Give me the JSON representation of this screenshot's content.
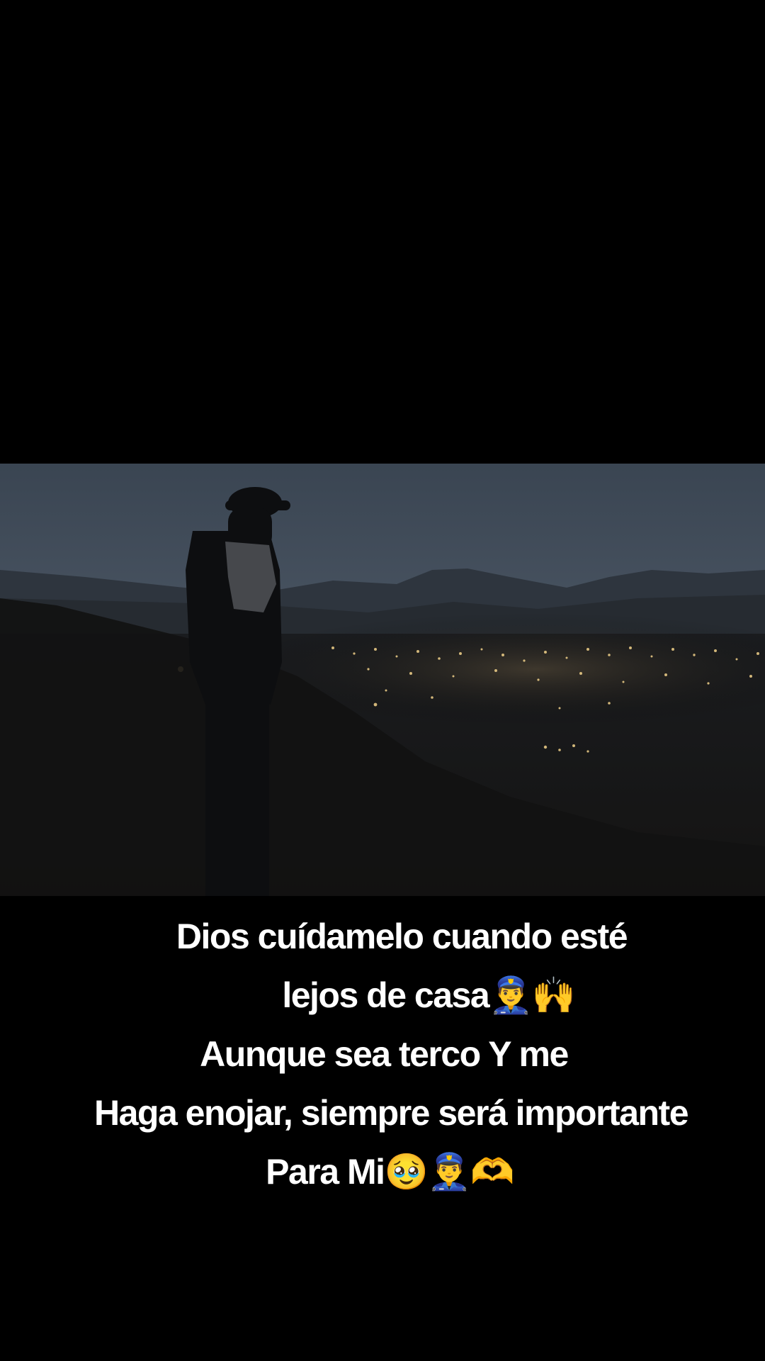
{
  "video": {
    "description_icon": "night-landscape-frame"
  },
  "caption": {
    "lines": [
      {
        "text": "Dios cuídamelo cuando esté",
        "emoji": ""
      },
      {
        "text": "lejos de casa",
        "emoji": "👮‍♂️🙌"
      },
      {
        "text": "Aunque sea terco Y me",
        "emoji": ""
      },
      {
        "text": "Haga enojar, siempre será importante",
        "emoji": ""
      },
      {
        "text": "Para Mi",
        "emoji": "🥹👮‍♂️🫶"
      }
    ]
  },
  "colors": {
    "background": "#000000",
    "caption_text": "#ffffff",
    "sky_top": "#3a4552",
    "city_lights": "#f2d28a"
  }
}
